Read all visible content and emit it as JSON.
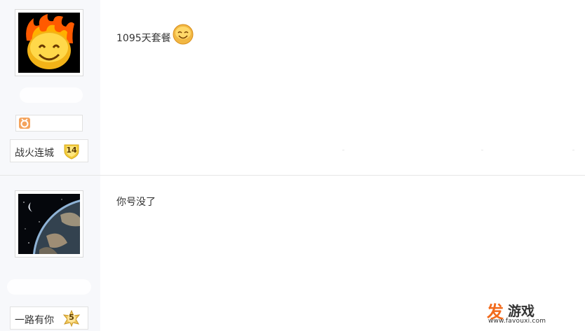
{
  "posts": [
    {
      "content": "1095天套餐",
      "level_name": "战火连城",
      "level_num": "14"
    },
    {
      "content": "你号没了",
      "level_name": "一路有你",
      "level_num": "5"
    }
  ],
  "watermark": {
    "brand_fa": "发",
    "brand_rest": "游戏",
    "url": "www.favouxi.com"
  },
  "colors": {
    "accent": "#f26a1b",
    "sidebar_bg": "#f7f8fb",
    "border": "#e1e1e1"
  }
}
